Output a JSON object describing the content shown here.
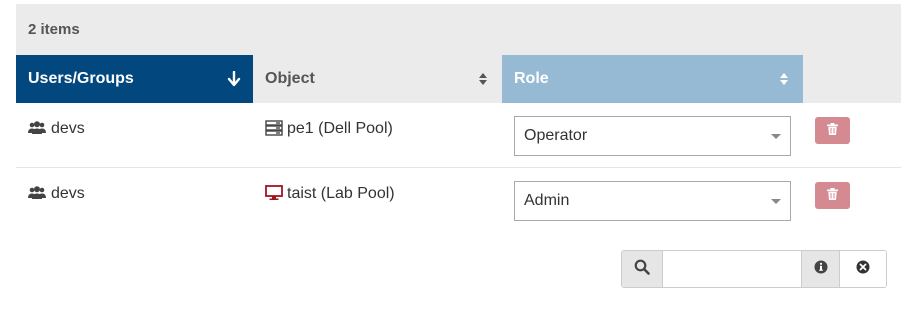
{
  "list": {
    "count_text": "2 items"
  },
  "columns": {
    "users": "Users/Groups",
    "object": "Object",
    "role": "Role"
  },
  "rows": [
    {
      "user": "devs",
      "user_icon": "users-group-icon",
      "object": "pe1 (Dell Pool)",
      "object_icon": "server-icon",
      "role": "Operator"
    },
    {
      "user": "devs",
      "user_icon": "users-group-icon",
      "object": "taist (Lab Pool)",
      "object_icon": "desktop-icon",
      "role": "Admin"
    }
  ],
  "search": {
    "value": "",
    "placeholder": ""
  },
  "colors": {
    "header_active": "#03477f",
    "header_role": "#96b9d4",
    "delete_button": "#d58a92",
    "desktop_icon": "#a01423"
  }
}
